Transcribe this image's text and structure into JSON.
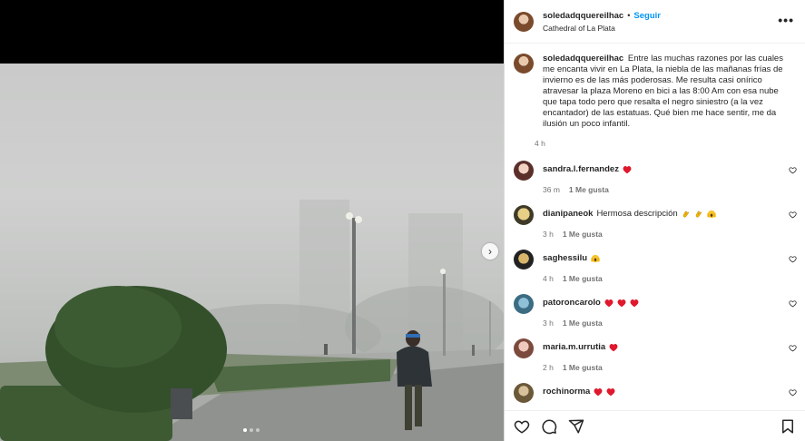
{
  "post": {
    "username": "soledadqquereilhac",
    "separator": "•",
    "follow_label": "Seguir",
    "location": "Cathedral of La Plata",
    "more_label": "•••",
    "caption": "Entre las muchas razones por las cuales me encanta vivir en La Plata, la niebla de las mañanas frías de invierno es de las más poderosas. Me resulta casi onírico atravesar la plaza Moreno en bici a las 8:00 Am con esa nube que tapa todo pero que resalta el negro siniestro (a la vez encantador) de las estatuas. Qué bien me hace sentir, me da ilusión un poco infantil.",
    "caption_time": "4 h"
  },
  "media": {
    "next_label": "›",
    "carousel_dots": 3,
    "active_dot": 1
  },
  "comments": [
    {
      "username": "sandra.l.fernandez",
      "text": "",
      "emojis": [
        "red-heart"
      ],
      "time": "36 m",
      "likes": "1 Me gusta"
    },
    {
      "username": "dianipaneok",
      "text": "Hermosa descripción",
      "emojis": [
        "clapping-hands",
        "clapping-hands",
        "face-screaming"
      ],
      "time": "3 h",
      "likes": "1 Me gusta"
    },
    {
      "username": "saghessilu",
      "text": "",
      "emojis": [
        "face-screaming"
      ],
      "time": "4 h",
      "likes": "1 Me gusta"
    },
    {
      "username": "patoroncarolo",
      "text": "",
      "emojis": [
        "red-heart",
        "red-heart",
        "red-heart"
      ],
      "time": "3 h",
      "likes": "1 Me gusta"
    },
    {
      "username": "maria.m.urrutia",
      "text": "",
      "emojis": [
        "red-heart"
      ],
      "time": "2 h",
      "likes": "1 Me gusta"
    },
    {
      "username": "rochinorma",
      "text": "",
      "emojis": [
        "red-heart",
        "red-heart"
      ],
      "time": "",
      "likes": ""
    }
  ],
  "actions": [
    "like-icon",
    "comment-icon",
    "share-icon",
    "save-icon"
  ],
  "colors": {
    "follow": "#0095f6",
    "heart": "#e0182d",
    "muted": "#737373",
    "text": "#262626"
  }
}
